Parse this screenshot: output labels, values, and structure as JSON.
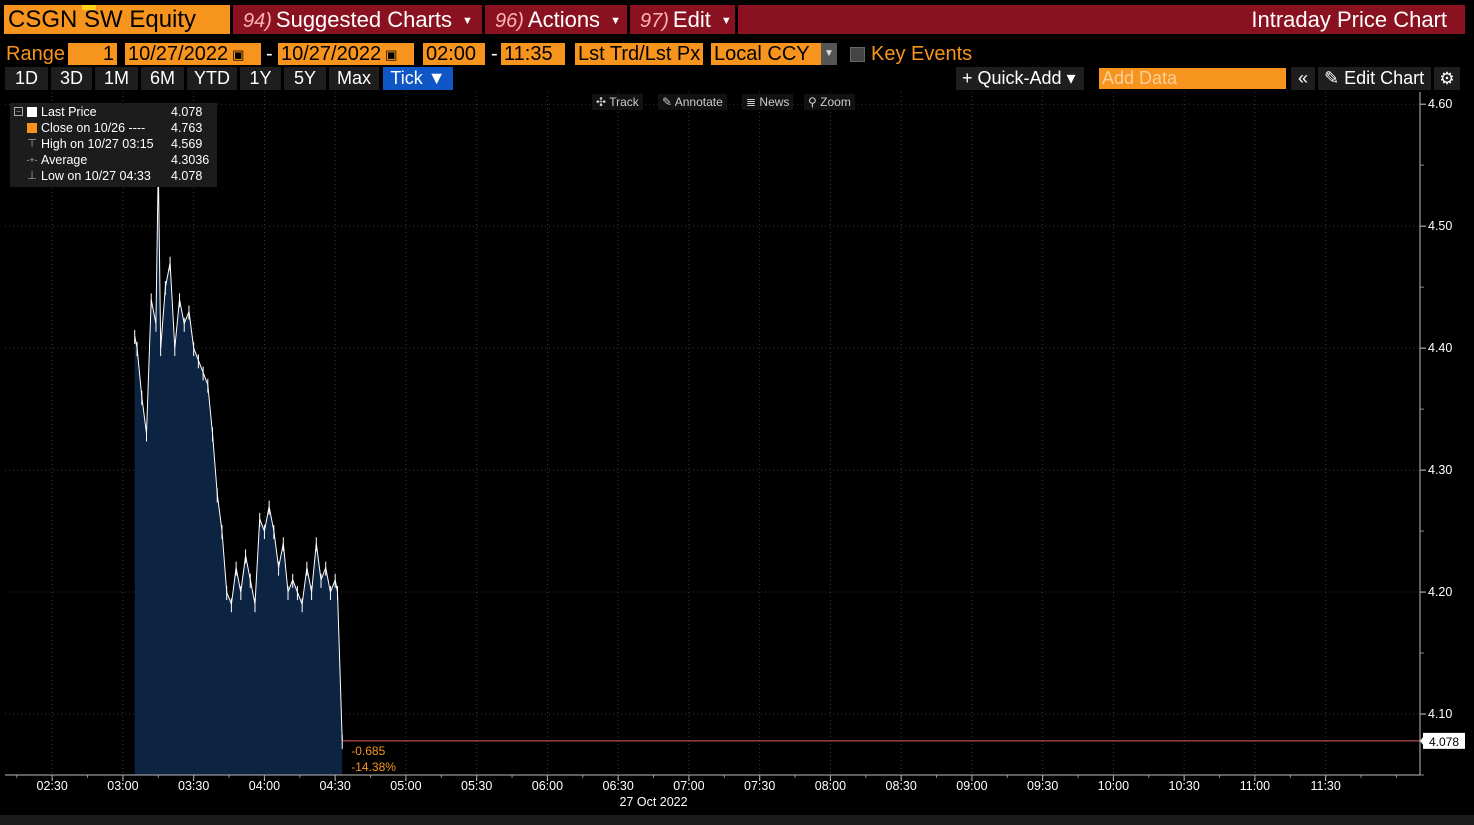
{
  "header": {
    "ticker": "CSGN SW Equity",
    "menus": [
      {
        "num": "94)",
        "label": "Suggested Charts"
      },
      {
        "num": "96)",
        "label": "Actions"
      },
      {
        "num": "97)",
        "label": "Edit"
      }
    ],
    "title": "Intraday Price Chart"
  },
  "range": {
    "label": "Range",
    "period": "1",
    "start_date": "10/27/2022",
    "end_date": "10/27/2022",
    "start_time": "02:00",
    "end_time": "11:35",
    "price_type": "Lst Trd/Lst Px",
    "currency": "Local CCY",
    "key_events_label": "Key Events",
    "key_events_checked": false
  },
  "periods": [
    "1D",
    "3D",
    "1M",
    "6M",
    "YTD",
    "1Y",
    "5Y",
    "Max",
    "Tick ▼"
  ],
  "active_period": "Tick ▼",
  "toolbar": {
    "quick_add": "+ Quick-Add ▾",
    "add_data_placeholder": "Add Data",
    "collapse": "«",
    "edit_chart": "Edit Chart",
    "settings": "⚙"
  },
  "chart_tools": [
    {
      "icon": "crosshair-icon",
      "glyph": "✣",
      "label": "Track"
    },
    {
      "icon": "pencil-icon",
      "glyph": "✎",
      "label": "Annotate"
    },
    {
      "icon": "news-icon",
      "glyph": "≣",
      "label": "News"
    },
    {
      "icon": "magnifier-icon",
      "glyph": "⚲",
      "label": "Zoom"
    }
  ],
  "legend": {
    "collapse_glyph": "−",
    "rows": [
      {
        "label": "Last Price",
        "value": "4.078",
        "marker": "square",
        "color": "#ffffff"
      },
      {
        "label": "Close on 10/26 ----",
        "value": "4.763",
        "marker": "square",
        "color": "#f7941d"
      },
      {
        "label": "High on 10/27 03:15",
        "value": "4.569",
        "marker": "glyph",
        "glyph": "⊤"
      },
      {
        "label": "Average",
        "value": "4.3036",
        "marker": "glyph",
        "glyph": "-+-"
      },
      {
        "label": "Low on 10/27 04:33",
        "value": "4.078",
        "marker": "glyph",
        "glyph": "⊥"
      }
    ]
  },
  "colors": {
    "accent_orange": "#f7941d",
    "menu_red": "#8a1220",
    "active_blue": "#0f57c6",
    "area_fill": "#0c2442",
    "last_price_line": "#e06060"
  },
  "chart_data": {
    "type": "area",
    "title": "",
    "x_label": "27 Oct 2022",
    "x_ticks": [
      "02:30",
      "03:00",
      "03:30",
      "04:00",
      "04:30",
      "05:00",
      "05:30",
      "06:00",
      "06:30",
      "07:00",
      "07:30",
      "08:00",
      "08:30",
      "09:00",
      "09:30",
      "10:00",
      "10:30",
      "11:00",
      "11:30"
    ],
    "y_ticks": [
      4.1,
      4.2,
      4.3,
      4.4,
      4.5,
      4.6
    ],
    "ylim": [
      4.05,
      4.61
    ],
    "xlim": [
      "02:10",
      "12:10"
    ],
    "y_axis_side": "right",
    "grid": true,
    "last_value_label": "4.078",
    "change_abs": "-0.685",
    "change_pct": "-14.38%",
    "series": [
      {
        "x": [
          "03:05",
          "03:06",
          "03:08",
          "03:10",
          "03:12",
          "03:14",
          "03:15",
          "03:16",
          "03:18",
          "03:20",
          "03:22",
          "03:24",
          "03:26",
          "03:28",
          "03:30",
          "03:32",
          "03:34",
          "03:36",
          "03:38",
          "03:40",
          "03:42",
          "03:44",
          "03:46",
          "03:48",
          "03:50",
          "03:52",
          "03:54",
          "03:56",
          "03:58",
          "04:00",
          "04:02",
          "04:04",
          "04:06",
          "04:08",
          "04:10",
          "04:12",
          "04:14",
          "04:16",
          "04:18",
          "04:20",
          "04:22",
          "04:24",
          "04:26",
          "04:28",
          "04:30",
          "04:31",
          "04:33"
        ],
        "y": [
          4.41,
          4.4,
          4.36,
          4.33,
          4.44,
          4.42,
          4.55,
          4.4,
          4.45,
          4.47,
          4.4,
          4.44,
          4.42,
          4.43,
          4.4,
          4.39,
          4.38,
          4.37,
          4.33,
          4.28,
          4.25,
          4.2,
          4.19,
          4.22,
          4.2,
          4.23,
          4.21,
          4.19,
          4.26,
          4.25,
          4.27,
          4.25,
          4.22,
          4.24,
          4.2,
          4.21,
          4.2,
          4.19,
          4.22,
          4.2,
          4.24,
          4.21,
          4.22,
          4.2,
          4.21,
          4.2,
          4.078
        ]
      }
    ]
  }
}
